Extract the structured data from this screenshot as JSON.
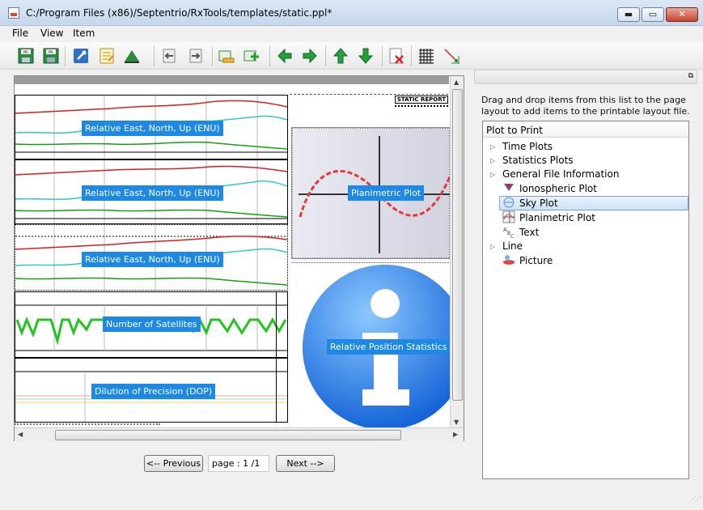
{
  "window": {
    "title": "C:/Program Files (x86)/Septentrio/RxTools/templates/static.ppl*",
    "min_glyph": "▬",
    "max_glyph": "▭",
    "close_glyph": "✕"
  },
  "menu": {
    "file": "File",
    "view": "View",
    "item": "Item"
  },
  "toolbar": {
    "icons": [
      "open-ppl-icon",
      "save-ppl-icon",
      "settings-icon",
      "properties-icon",
      "fill-icon",
      "align-left-icon",
      "align-right-icon",
      "decrease-size-icon",
      "increase-size-icon",
      "move-left-icon",
      "move-right-icon",
      "move-up-icon",
      "move-down-icon",
      "delete-icon",
      "grid-icon",
      "snap-icon"
    ]
  },
  "layout": {
    "header_title": "STATIC REPORT",
    "plots": [
      {
        "label": "Relative East, North, Up (ENU)"
      },
      {
        "label": "Relative East, North, Up (ENU)"
      },
      {
        "label": "Relative East, North, Up (ENU)"
      },
      {
        "label": "Number of Satellites"
      },
      {
        "label": "Dilution of Precision (DOP)"
      }
    ],
    "planimetric_label": "Planimetric Plot",
    "stats_label": "Relative Position Statistics"
  },
  "nav": {
    "previous": "<-- Previous",
    "page": "page : 1 /1",
    "next": "Next -->"
  },
  "right_panel": {
    "description": "Drag and drop items from this list to the page layout to add items to the printable layout file.",
    "tree_header": "Plot to Print",
    "items": [
      {
        "label": "Time Plots",
        "icon": "expand-arrow-icon"
      },
      {
        "label": "Statistics Plots",
        "icon": "expand-arrow-icon"
      },
      {
        "label": "General File Information",
        "icon": "expand-arrow-icon"
      },
      {
        "label": "Ionospheric Plot",
        "icon": "ionospheric-icon"
      },
      {
        "label": "Sky Plot",
        "icon": "sky-plot-icon",
        "selected": true
      },
      {
        "label": "Planimetric Plot",
        "icon": "planimetric-icon"
      },
      {
        "label": "Text",
        "icon": "text-icon"
      },
      {
        "label": "Line",
        "icon": "expand-arrow-icon"
      },
      {
        "label": "Picture",
        "icon": "picture-icon"
      }
    ]
  },
  "colors": {
    "overlay": "#1e88e5",
    "selection": "#cfe2f8",
    "title_gradient": "#c6d8ec"
  }
}
